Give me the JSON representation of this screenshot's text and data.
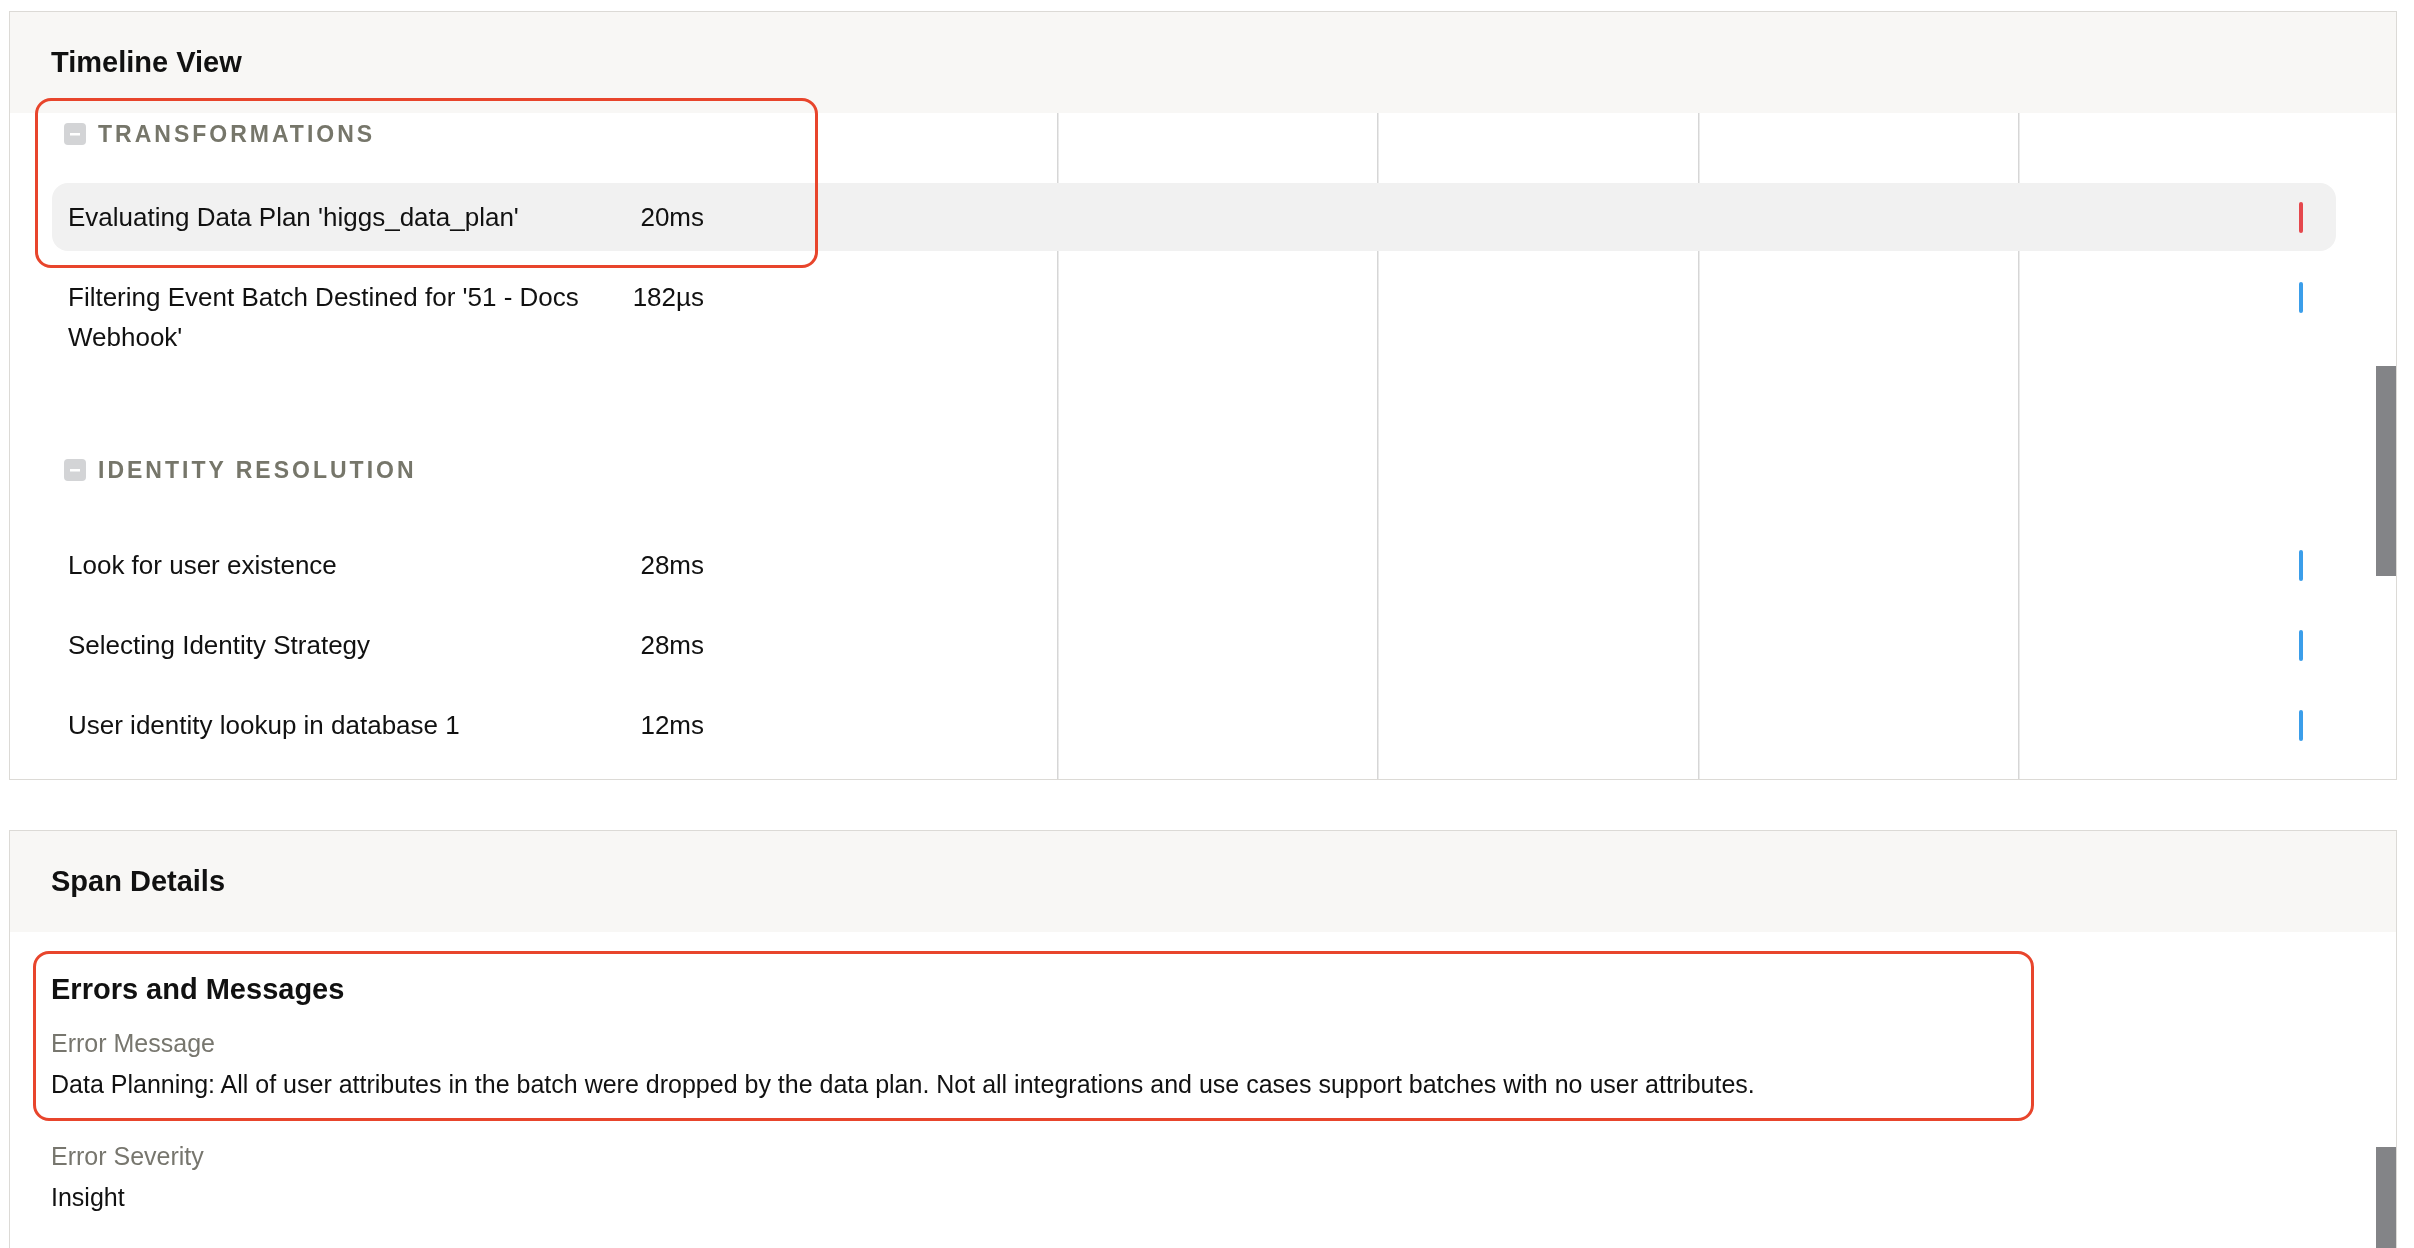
{
  "timeline": {
    "title": "Timeline View",
    "groups": [
      {
        "label": "TRANSFORMATIONS",
        "expanded": true,
        "annotated": true,
        "spans": [
          {
            "name": "Evaluating Data Plan 'higgs_data_plan'",
            "duration": "20ms",
            "selected": true,
            "color": "#e5484d"
          },
          {
            "name": "Filtering Event Batch Destined for '51 - Docs Webhook'",
            "duration": "182µs",
            "selected": false,
            "color": "#3b9eea"
          }
        ]
      },
      {
        "label": "IDENTITY RESOLUTION",
        "expanded": true,
        "annotated": false,
        "spans": [
          {
            "name": "Look for user existence",
            "duration": "28ms",
            "selected": false,
            "color": "#3b9eea"
          },
          {
            "name": "Selecting Identity Strategy",
            "duration": "28ms",
            "selected": false,
            "color": "#3b9eea"
          },
          {
            "name": "User identity lookup in database 1",
            "duration": "12ms",
            "selected": false,
            "color": "#3b9eea"
          }
        ]
      }
    ]
  },
  "span_details": {
    "title": "Span Details",
    "blocks": [
      {
        "annotated": true,
        "heading": "Errors and Messages",
        "fields": [
          {
            "label": "Error Message",
            "value": "Data Planning: All of user attributes in the batch were dropped by the data plan. Not all integrations and use cases support batches with no user attributes."
          }
        ]
      },
      {
        "annotated": false,
        "fields": [
          {
            "label": "Error Severity",
            "value": "Insight"
          }
        ]
      }
    ]
  }
}
